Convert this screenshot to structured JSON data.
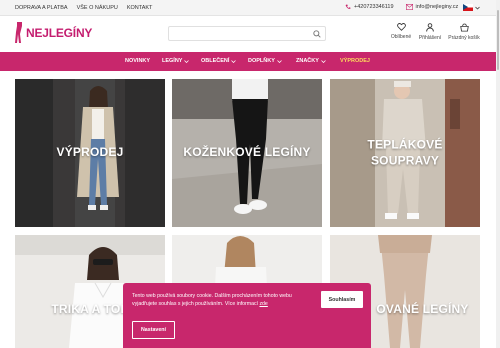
{
  "topbar": {
    "links": [
      "DOPRAVA A PLATBA",
      "VŠE O NÁKUPU",
      "KONTAKT"
    ],
    "phone": "+420723346119",
    "email": "info@nejleginy.cz"
  },
  "logo": {
    "text": "NEJLEGÍNY"
  },
  "search": {
    "placeholder": ""
  },
  "header_icons": {
    "favorites": "Oblíbené",
    "login": "Přihlášení",
    "cart": "Prázdný košík"
  },
  "nav": {
    "items": [
      "NOVINKY",
      "LEGÍNY",
      "OBLEČENÍ",
      "DOPLŇKY",
      "ZNAČKY",
      "VÝPRODEJ"
    ]
  },
  "tiles": [
    {
      "label": "VÝPRODEJ"
    },
    {
      "label": "KOŽENKOVÉ LEGÍNY"
    },
    {
      "label": "TEPLÁKOVÉ SOUPRAVY"
    },
    {
      "label": "TRIKA A TOP"
    },
    {
      "label": ""
    },
    {
      "label": "OVANÉ LEGÍNY"
    }
  ],
  "cookie": {
    "message": "Tento web používá soubory cookie. Dalším procházením tohoto webu vyjadřujete souhlas s jejich používáním. Více informací ",
    "link": "zde",
    "accept": "Souhlasím",
    "settings": "Nastavení"
  },
  "colors": {
    "brand": "#c8276c",
    "sale": "#ffdc5c"
  }
}
